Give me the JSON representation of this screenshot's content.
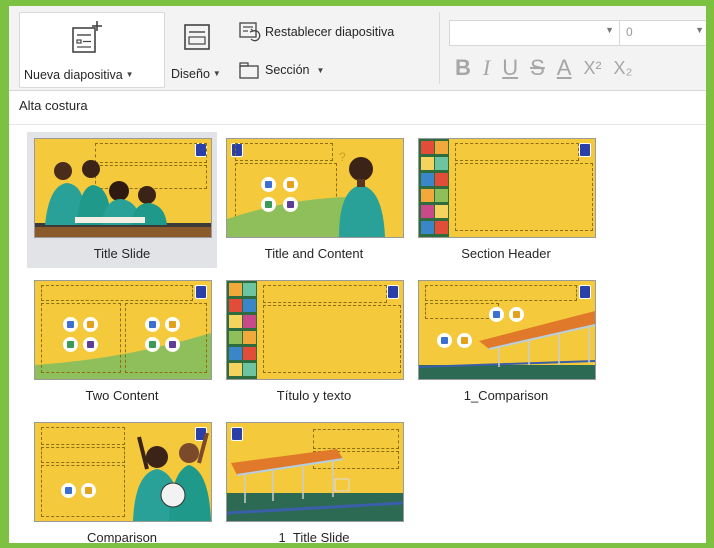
{
  "ribbon": {
    "new_slide_label": "Nueva diapositiva",
    "layout_label": "Diseño",
    "reset_label": "Restablecer diapositiva",
    "section_label": "Sección",
    "font_name_value": "",
    "font_size_value": "0",
    "format_buttons": [
      "B",
      "I",
      "U",
      "S",
      "A",
      "X²",
      "X₂"
    ]
  },
  "gallery": {
    "theme_name": "Alta costura",
    "layouts": [
      {
        "label": "Title Slide",
        "selected": true
      },
      {
        "label": "Title and Content",
        "selected": false
      },
      {
        "label": "Section Header",
        "selected": false
      },
      {
        "label": "Two Content",
        "selected": false
      },
      {
        "label": "Título y texto",
        "selected": false
      },
      {
        "label": "1_Comparison",
        "selected": false
      },
      {
        "label": "Comparison",
        "selected": false
      },
      {
        "label": "1_Title Slide",
        "selected": false
      }
    ]
  },
  "colors": {
    "frame_border": "#7dc142",
    "slide_yellow": "#f5c93c",
    "selection": "#e1e3e6",
    "logo_blue": "#2a3fa8"
  }
}
